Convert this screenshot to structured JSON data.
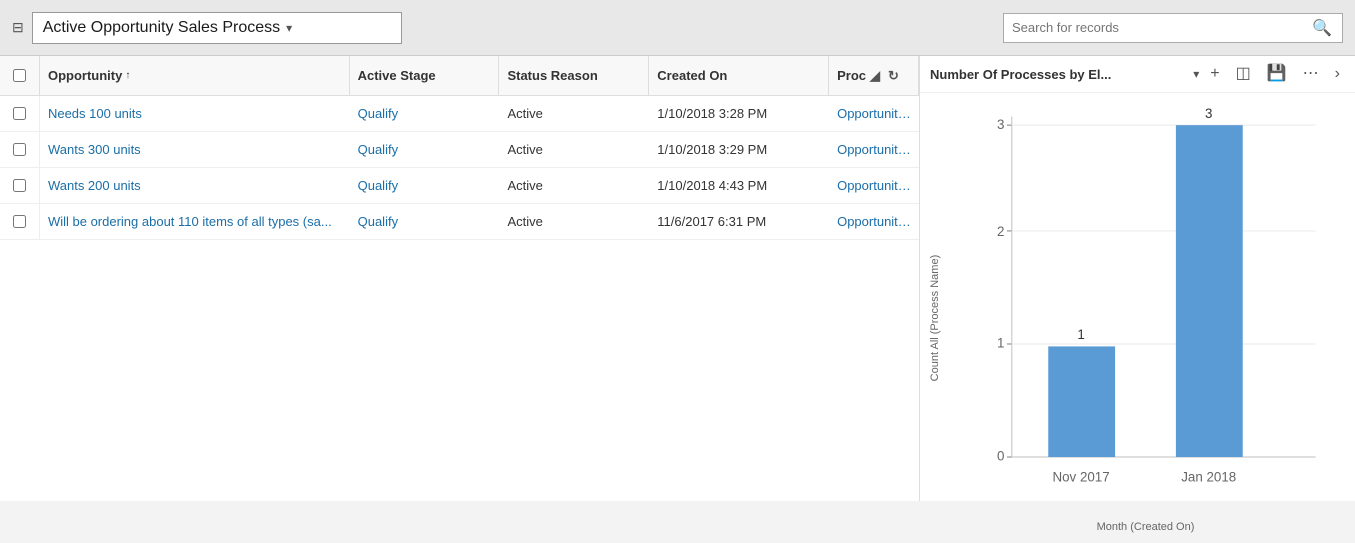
{
  "header": {
    "icon": "⊞",
    "title": "Active Opportunity Sales Process",
    "dropdown_arrow": "▾",
    "search_placeholder": "Search for records",
    "search_icon": "🔍"
  },
  "table": {
    "columns": [
      {
        "id": "opportunity",
        "label": "Opportunity",
        "sort": "asc"
      },
      {
        "id": "active_stage",
        "label": "Active Stage"
      },
      {
        "id": "status_reason",
        "label": "Status Reason"
      },
      {
        "id": "created_on",
        "label": "Created On"
      },
      {
        "id": "process",
        "label": "Proc"
      }
    ],
    "rows": [
      {
        "opportunity": "Needs 100 units",
        "active_stage": "Qualify",
        "status_reason": "Active",
        "created_on": "1/10/2018 3:28 PM",
        "process": "Opportunity Sa"
      },
      {
        "opportunity": "Wants 300 units",
        "active_stage": "Qualify",
        "status_reason": "Active",
        "created_on": "1/10/2018 3:29 PM",
        "process": "Opportunity Sa"
      },
      {
        "opportunity": "Wants 200 units",
        "active_stage": "Qualify",
        "status_reason": "Active",
        "created_on": "1/10/2018 4:43 PM",
        "process": "Opportunity Sa"
      },
      {
        "opportunity": "Will be ordering about 110 items of all types (sa...",
        "active_stage": "Qualify",
        "status_reason": "Active",
        "created_on": "11/6/2017 6:31 PM",
        "process": "Opportunity Sa"
      }
    ]
  },
  "chart": {
    "title": "Number Of Processes by El...",
    "y_axis_label": "Count All (Process Name)",
    "x_axis_label": "Month (Created On)",
    "bars": [
      {
        "label": "Nov 2017",
        "value": 1,
        "max": 3
      },
      {
        "label": "Jan 2018",
        "value": 3,
        "max": 3
      }
    ],
    "y_ticks": [
      0,
      1,
      2,
      3
    ],
    "bar_color": "#5b9bd5",
    "actions": {
      "add": "+",
      "expand": "⊞",
      "save": "💾",
      "more": "···",
      "chevron": "›"
    }
  }
}
